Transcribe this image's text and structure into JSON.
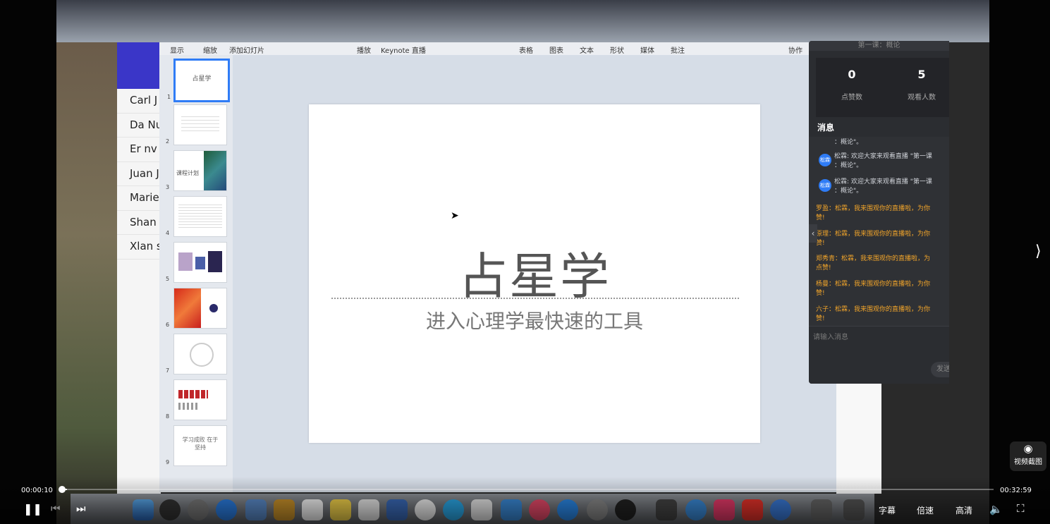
{
  "keynote": {
    "toolbar_left": [
      "显示",
      "缩放",
      "添加幻灯片"
    ],
    "toolbar_mid": [
      "播放",
      "Keynote 直播"
    ],
    "toolbar_right": [
      "表格",
      "图表",
      "文本",
      "形状",
      "媒体",
      "批注"
    ],
    "collab": "协作"
  },
  "contacts": [
    "Carl J",
    "Da Nu",
    "Er nv",
    "Juan J",
    "Marie",
    "Shan",
    "Xlan s"
  ],
  "thumbs": [
    {
      "num": "1",
      "text": "占星学"
    },
    {
      "num": "2",
      "text": ""
    },
    {
      "num": "3",
      "text": "课程计划"
    },
    {
      "num": "4",
      "text": ""
    },
    {
      "num": "5",
      "text": ""
    },
    {
      "num": "6",
      "text": ""
    },
    {
      "num": "7",
      "text": ""
    },
    {
      "num": "8",
      "text": ""
    },
    {
      "num": "9",
      "text": "学习成败 在于坚持"
    }
  ],
  "slide": {
    "title": "占星学",
    "subtitle": "进入心理学最快速的工具"
  },
  "chat": {
    "window_title": "第一课：概论",
    "likes_value": "0",
    "likes_label": "点赞数",
    "viewers_value": "5",
    "viewers_label": "观看人数",
    "messages_header": "消息",
    "messages": [
      {
        "type": "sys",
        "text": "：概论\"。"
      },
      {
        "type": "sys",
        "avatar": "松霖",
        "text": "松霖: 欢迎大家来观看直播 \"第一课",
        "text2": "：概论\"。"
      },
      {
        "type": "sys",
        "avatar": "松霖",
        "text": "松霖: 欢迎大家来观看直播 \"第一课",
        "text2": "：概论\"。"
      },
      {
        "type": "fan",
        "text": "罗盈：松霖，我来围观你的直播啦，为你",
        "text2": "赞!"
      },
      {
        "type": "fan",
        "text": "原理：松霖，我来围观你的直播啦，为你",
        "text2": "赞!"
      },
      {
        "type": "fan",
        "text": "郑秀青：松霖，我来围观你的直播啦，为",
        "text2": "点赞!"
      },
      {
        "type": "fan",
        "text": "杨曼：松霖，我来围观你的直播啦，为你",
        "text2": "赞!"
      },
      {
        "type": "fan",
        "text": "六子：松霖，我来围观你的直播啦，为你",
        "text2": "赞!"
      }
    ],
    "input_placeholder": "请输入消息",
    "send_label": "发送"
  },
  "player": {
    "current_time": "00:00:10",
    "total_time": "00:32:59",
    "progress": 0.005,
    "subtitles_label": "字幕",
    "speed_label": "倍速",
    "quality_label": "高清",
    "screenshot_label": "视频截图"
  },
  "colors": {
    "accent": "#2f7cf6",
    "quality": "#ffffff",
    "fan_message": "#f2a52a"
  }
}
